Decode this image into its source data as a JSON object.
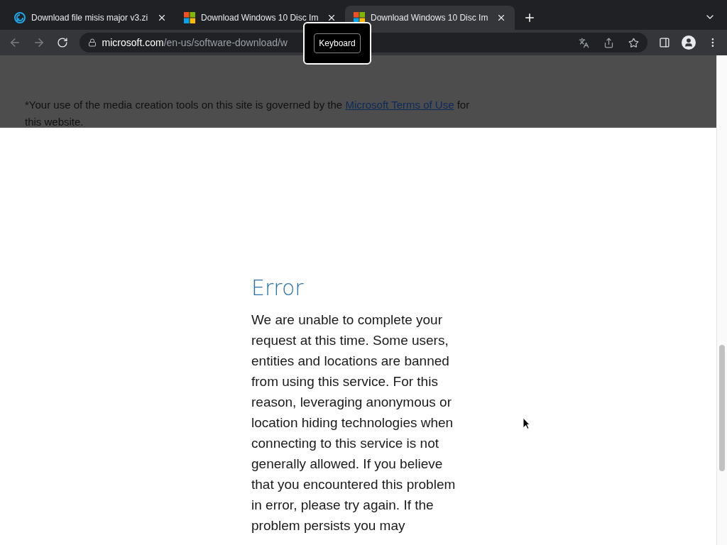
{
  "tabs": [
    {
      "title": "Download file misis major v3.zi",
      "kind": "swirl",
      "selected": false
    },
    {
      "title": "Download Windows 10 Disc Im",
      "kind": "windows",
      "selected": false
    },
    {
      "title": "Download Windows 10 Disc Im",
      "kind": "windows",
      "selected": true
    }
  ],
  "address": {
    "domain": "microsoft.com",
    "path": "/en-us/software-download/w"
  },
  "tooltip": "Keyboard",
  "notice": {
    "text": "*Your use of the media creation tools on this site is governed by the",
    "link": "Microsoft Terms of Use",
    "after": "for this website."
  },
  "error": {
    "title": "Error",
    "message": "We are unable to complete your request at this time. Some users, entities and locations are banned from using this service. For this reason, leveraging anonymous or location hiding technologies when connecting to this service is not generally allowed. If you believe that you encountered this problem in error, please try again. If the problem persists you may"
  }
}
